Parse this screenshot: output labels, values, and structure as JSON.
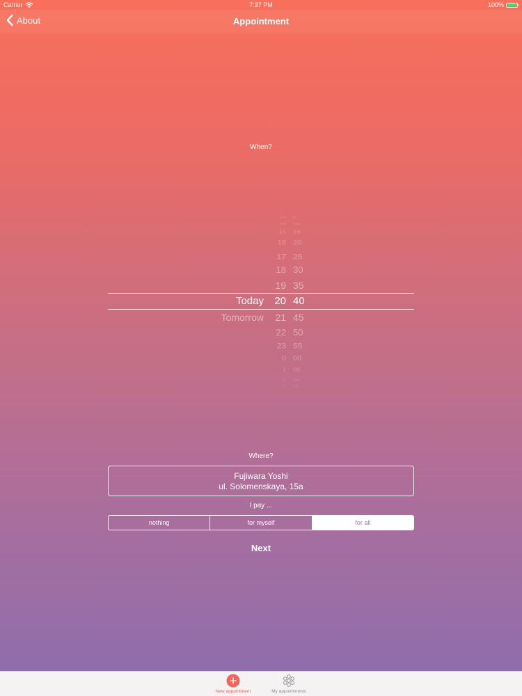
{
  "status_bar": {
    "carrier": "Carrier",
    "time": "7:37 PM",
    "battery": "100%"
  },
  "nav": {
    "back_label": "About",
    "title": "Appointment"
  },
  "when_label": "When?",
  "picker": {
    "days": [
      "Today",
      "Tomorrow"
    ],
    "selected_day": "Today",
    "hours": [
      "12",
      "13",
      "14",
      "15",
      "16",
      "17",
      "18",
      "19",
      "20",
      "21",
      "22",
      "23",
      "0",
      "1",
      "2",
      "3"
    ],
    "selected_hour": "20",
    "minutes": [
      "0",
      "5",
      "10",
      "15",
      "20",
      "25",
      "30",
      "35",
      "40",
      "45",
      "50",
      "55",
      "00",
      "05",
      "10",
      "15"
    ],
    "selected_minute": "40"
  },
  "where_label": "Where?",
  "where": {
    "name": "Fujiwara Yoshi",
    "address": "ul. Solomenskaya, 15a"
  },
  "pay_label": "I pay ...",
  "pay_options": [
    "nothing",
    "for myself",
    "for all"
  ],
  "pay_selected": "for all",
  "next_label": "Next",
  "tabs": [
    {
      "label": "New appointment",
      "icon": "plus-circle-icon",
      "active": true
    },
    {
      "label": "My appointments",
      "icon": "flower-icon",
      "active": false
    }
  ],
  "colors": {
    "accent": "#f1665a",
    "tab_inactive": "#8e8e93",
    "gradient_top": "#f86f5c",
    "gradient_bottom": "#8a6dae"
  }
}
